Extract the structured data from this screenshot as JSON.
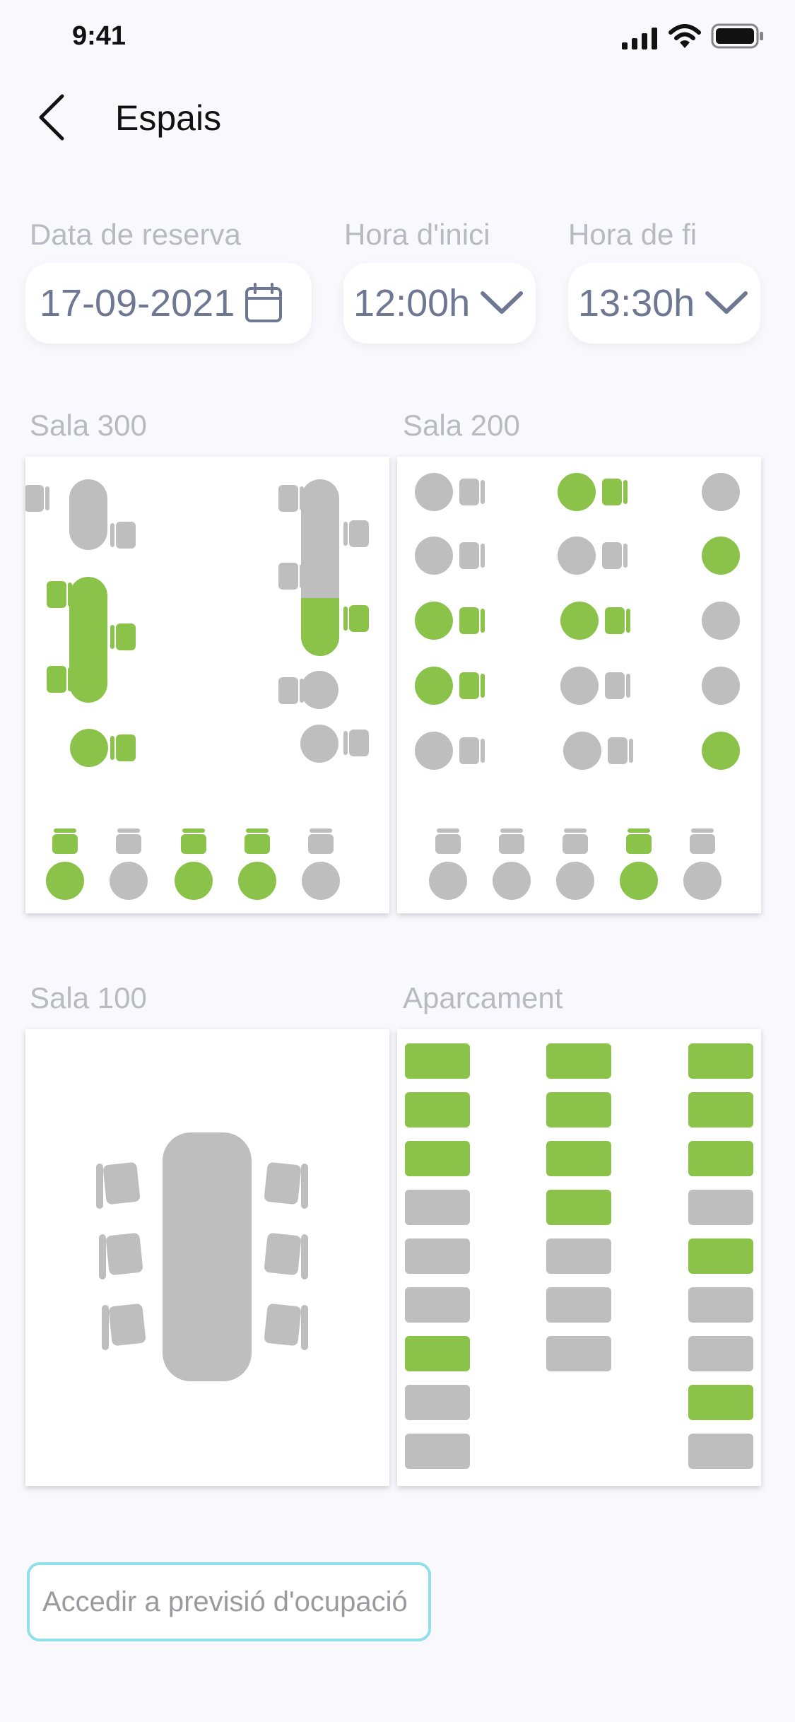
{
  "status_bar": {
    "time": "9:41"
  },
  "header": {
    "title": "Espais"
  },
  "filters": {
    "date": {
      "label": "Data de reserva",
      "value": "17-09-2021"
    },
    "start": {
      "label": "Hora d'inici",
      "value": "12:00h"
    },
    "end": {
      "label": "Hora de fi",
      "value": "13:30h"
    }
  },
  "rooms": {
    "sala300": "Sala 300",
    "sala200": "Sala 200",
    "sala100": "Sala 100",
    "parking": "Aparcament"
  },
  "cta": {
    "label": "Accedir a previsió d'ocupació"
  },
  "colors": {
    "occupied": "#8bc34a",
    "free": "#bebebe",
    "accent_border": "#8fe0e8"
  },
  "parking_occupancy": {
    "col1": [
      true,
      true,
      true,
      false,
      false,
      false,
      true,
      false,
      false
    ],
    "col2": [
      true,
      true,
      true,
      true,
      false,
      false,
      false
    ],
    "col3": [
      true,
      true,
      true,
      false,
      true,
      false,
      false,
      true,
      false
    ]
  }
}
